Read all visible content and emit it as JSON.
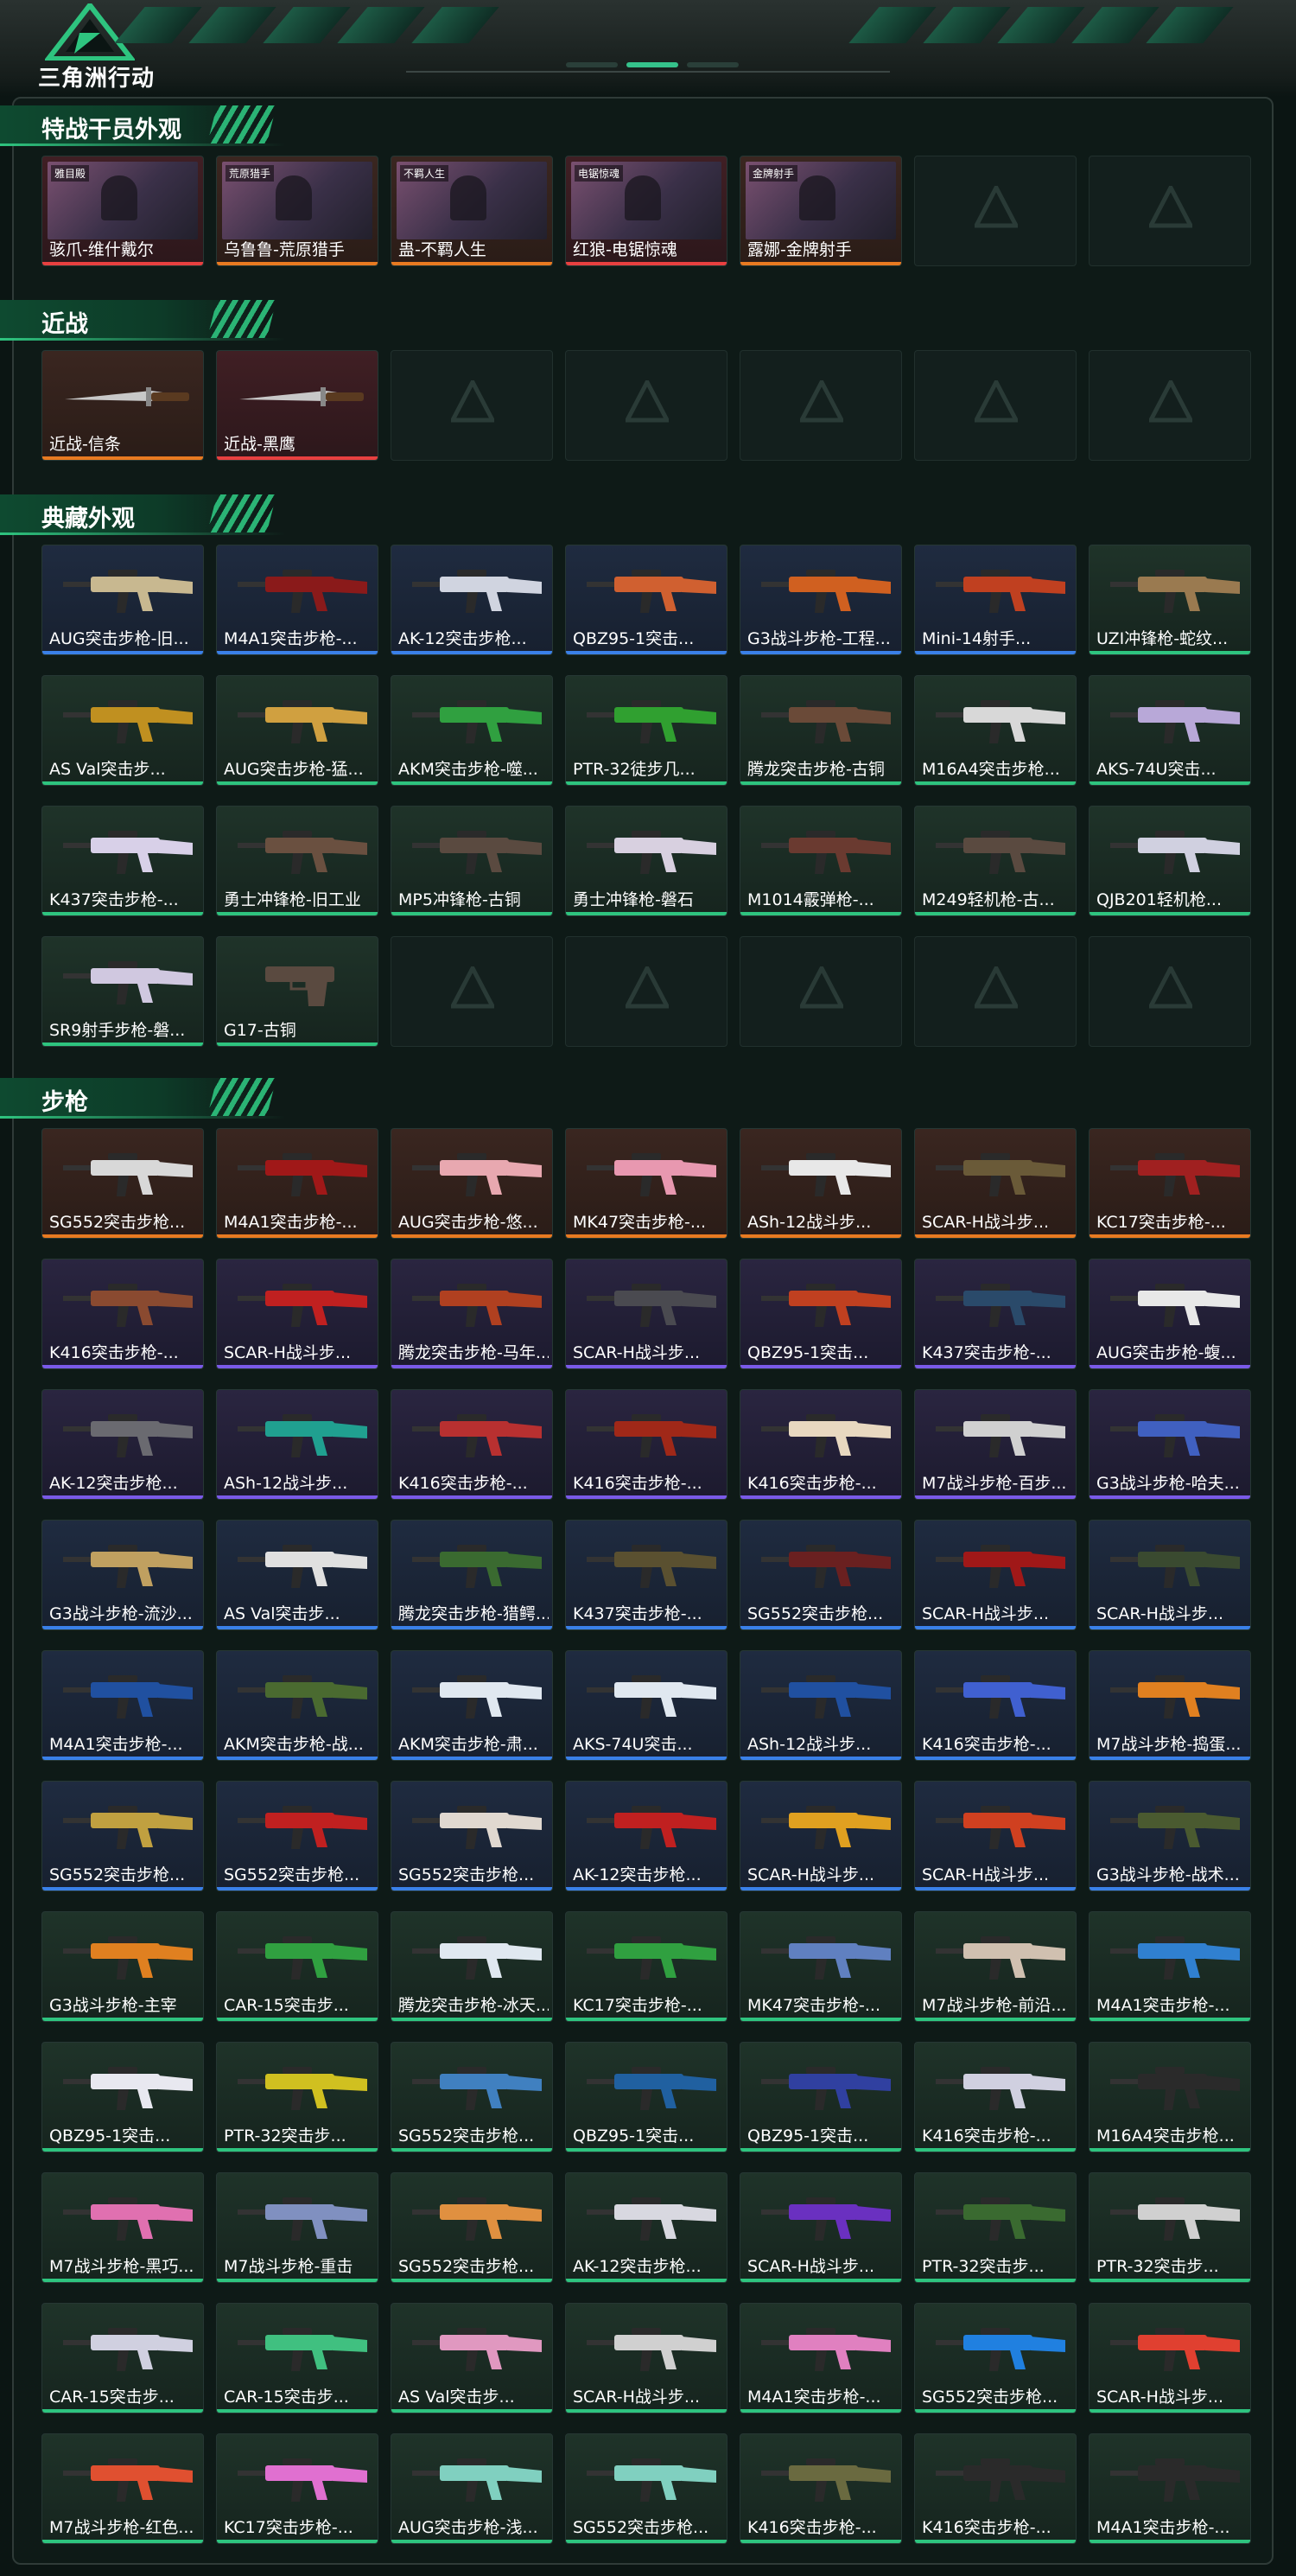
{
  "app": {
    "logo_text": "三角洲行动"
  },
  "header": {
    "progress_active_index": 1
  },
  "sections": [
    {
      "id": "operator-skins",
      "title": "特战干员外观",
      "items": [
        {
          "label": "骇爪-维什戴尔",
          "rarity": "red",
          "kind": "portrait",
          "badge": "雅目殿"
        },
        {
          "label": "乌鲁鲁-荒原猎手",
          "rarity": "orange",
          "kind": "portrait",
          "badge": "荒原猎手"
        },
        {
          "label": "蛊-不羁人生",
          "rarity": "orange",
          "kind": "portrait",
          "badge": "不羁人生"
        },
        {
          "label": "红狼-电锯惊魂",
          "rarity": "red",
          "kind": "portrait",
          "badge": "电锯惊魂"
        },
        {
          "label": "露娜-金牌射手",
          "rarity": "orange",
          "kind": "portrait",
          "badge": "金牌射手"
        },
        {
          "label": "",
          "rarity": "empty",
          "kind": "empty"
        },
        {
          "label": "",
          "rarity": "empty",
          "kind": "empty"
        }
      ]
    },
    {
      "id": "melee",
      "title": "近战",
      "items": [
        {
          "label": "近战-信条",
          "rarity": "orange",
          "kind": "knife"
        },
        {
          "label": "近战-黑鹰",
          "rarity": "red",
          "kind": "knife"
        },
        {
          "label": "",
          "rarity": "empty",
          "kind": "empty"
        },
        {
          "label": "",
          "rarity": "empty",
          "kind": "empty"
        },
        {
          "label": "",
          "rarity": "empty",
          "kind": "empty"
        },
        {
          "label": "",
          "rarity": "empty",
          "kind": "empty"
        },
        {
          "label": "",
          "rarity": "empty",
          "kind": "empty"
        }
      ]
    },
    {
      "id": "collection",
      "title": "典藏外观",
      "items": [
        {
          "label": "AUG突击步枪-旧...",
          "rarity": "blue",
          "kind": "gun",
          "color": "#c8b890"
        },
        {
          "label": "M4A1突击步枪-...",
          "rarity": "blue",
          "kind": "gun",
          "color": "#8a1a1a"
        },
        {
          "label": "AK-12突击步枪...",
          "rarity": "blue",
          "kind": "gun",
          "color": "#d0d4e0"
        },
        {
          "label": "QBZ95-1突击...",
          "rarity": "blue",
          "kind": "gun",
          "color": "#d06030"
        },
        {
          "label": "G3战斗步枪-工程...",
          "rarity": "blue",
          "kind": "gun",
          "color": "#d06020"
        },
        {
          "label": "Mini-14射手...",
          "rarity": "blue",
          "kind": "gun",
          "color": "#c04020"
        },
        {
          "label": "UZI冲锋枪-蛇纹...",
          "rarity": "green",
          "kind": "gun",
          "color": "#9a7a50"
        },
        {
          "label": "AS Val突击步...",
          "rarity": "green",
          "kind": "gun",
          "color": "#c09020"
        },
        {
          "label": "AUG突击步枪-猛...",
          "rarity": "green",
          "kind": "gun",
          "color": "#d0a040"
        },
        {
          "label": "AKM突击步枪-噬...",
          "rarity": "green",
          "kind": "gun",
          "color": "#30a040"
        },
        {
          "label": "PTR-32徒步几...",
          "rarity": "green",
          "kind": "gun",
          "color": "#30a030"
        },
        {
          "label": "腾龙突击步枪-古铜",
          "rarity": "green",
          "kind": "gun",
          "color": "#6a4a38"
        },
        {
          "label": "M16A4突击步枪...",
          "rarity": "green",
          "kind": "gun",
          "color": "#d8d8d8"
        },
        {
          "label": "AKS-74U突击...",
          "rarity": "green",
          "kind": "gun",
          "color": "#b8a8d8"
        },
        {
          "label": "K437突击步枪-...",
          "rarity": "green",
          "kind": "gun",
          "color": "#d8d0e8"
        },
        {
          "label": "勇士冲锋枪-旧工业",
          "rarity": "green",
          "kind": "gun",
          "color": "#6a5040"
        },
        {
          "label": "MP5冲锋枪-古铜",
          "rarity": "green",
          "kind": "gun",
          "color": "#5a4a40"
        },
        {
          "label": "勇士冲锋枪-磐石",
          "rarity": "green",
          "kind": "gun",
          "color": "#d8d0e0"
        },
        {
          "label": "M1014霰弹枪-...",
          "rarity": "green",
          "kind": "gun",
          "color": "#6a3a30"
        },
        {
          "label": "M249轻机枪-古...",
          "rarity": "green",
          "kind": "gun",
          "color": "#5a4a40"
        },
        {
          "label": "QJB201轻机枪...",
          "rarity": "green",
          "kind": "gun",
          "color": "#d0d0e0"
        },
        {
          "label": "SR9射手步枪-磐...",
          "rarity": "green",
          "kind": "gun",
          "color": "#d0c8e0"
        },
        {
          "label": "G17-古铜",
          "rarity": "green",
          "kind": "pistol",
          "color": "#5a4a40"
        },
        {
          "label": "",
          "rarity": "empty",
          "kind": "empty"
        },
        {
          "label": "",
          "rarity": "empty",
          "kind": "empty"
        },
        {
          "label": "",
          "rarity": "empty",
          "kind": "empty"
        },
        {
          "label": "",
          "rarity": "empty",
          "kind": "empty"
        },
        {
          "label": "",
          "rarity": "empty",
          "kind": "empty"
        }
      ]
    },
    {
      "id": "rifles",
      "title": "步枪",
      "items": [
        {
          "label": "SG552突击步枪...",
          "rarity": "orange",
          "kind": "gun",
          "color": "#d8d8d8"
        },
        {
          "label": "M4A1突击步枪-...",
          "rarity": "orange",
          "kind": "gun",
          "color": "#a01818"
        },
        {
          "label": "AUG突击步枪-悠...",
          "rarity": "orange",
          "kind": "gun",
          "color": "#e8a8b0"
        },
        {
          "label": "MK47突击步枪-...",
          "rarity": "orange",
          "kind": "gun",
          "color": "#e898b0"
        },
        {
          "label": "ASh-12战斗步...",
          "rarity": "orange",
          "kind": "gun",
          "color": "#e8e8e8"
        },
        {
          "label": "SCAR-H战斗步...",
          "rarity": "orange",
          "kind": "gun",
          "color": "#6a5a38"
        },
        {
          "label": "KC17突击步枪-...",
          "rarity": "orange",
          "kind": "gun",
          "color": "#a02020"
        },
        {
          "label": "K416突击步枪-...",
          "rarity": "purple",
          "kind": "gun",
          "color": "#8a4a30"
        },
        {
          "label": "SCAR-H战斗步...",
          "rarity": "purple",
          "kind": "gun",
          "color": "#c02020"
        },
        {
          "label": "腾龙突击步枪-马年...",
          "rarity": "purple",
          "kind": "gun",
          "color": "#b04020"
        },
        {
          "label": "SCAR-H战斗步...",
          "rarity": "purple",
          "kind": "gun",
          "color": "#4a4a50"
        },
        {
          "label": "QBZ95-1突击...",
          "rarity": "purple",
          "kind": "gun",
          "color": "#c04020"
        },
        {
          "label": "K437突击步枪-...",
          "rarity": "purple",
          "kind": "gun",
          "color": "#2a4a6a"
        },
        {
          "label": "AUG突击步枪-蝮...",
          "rarity": "purple",
          "kind": "gun",
          "color": "#e8e8e8"
        },
        {
          "label": "AK-12突击步枪...",
          "rarity": "purple",
          "kind": "gun",
          "color": "#6a6a70"
        },
        {
          "label": "ASh-12战斗步...",
          "rarity": "purple",
          "kind": "gun",
          "color": "#20a090"
        },
        {
          "label": "K416突击步枪-...",
          "rarity": "purple",
          "kind": "gun",
          "color": "#b83030"
        },
        {
          "label": "K416突击步枪-...",
          "rarity": "purple",
          "kind": "gun",
          "color": "#a02818"
        },
        {
          "label": "K416突击步枪-...",
          "rarity": "purple",
          "kind": "gun",
          "color": "#e8d8c0"
        },
        {
          "label": "M7战斗步枪-百步...",
          "rarity": "purple",
          "kind": "gun",
          "color": "#d0d0d0"
        },
        {
          "label": "G3战斗步枪-哈夫...",
          "rarity": "purple",
          "kind": "gun",
          "color": "#4060c0"
        },
        {
          "label": "G3战斗步枪-流沙...",
          "rarity": "blue",
          "kind": "gun",
          "color": "#c0a060"
        },
        {
          "label": "AS Val突击步...",
          "rarity": "blue",
          "kind": "gun",
          "color": "#e0e0e0"
        },
        {
          "label": "腾龙突击步枪-猎鳄...",
          "rarity": "blue",
          "kind": "gun",
          "color": "#3a6a30"
        },
        {
          "label": "K437突击步枪-...",
          "rarity": "blue",
          "kind": "gun",
          "color": "#5a5030"
        },
        {
          "label": "SG552突击步枪...",
          "rarity": "blue",
          "kind": "gun",
          "color": "#6a2020"
        },
        {
          "label": "SCAR-H战斗步...",
          "rarity": "blue",
          "kind": "gun",
          "color": "#a01818"
        },
        {
          "label": "SCAR-H战斗步...",
          "rarity": "blue",
          "kind": "gun",
          "color": "#3a4a30"
        },
        {
          "label": "M4A1突击步枪-...",
          "rarity": "blue",
          "kind": "gun",
          "color": "#2050a0"
        },
        {
          "label": "AKM突击步枪-战...",
          "rarity": "blue",
          "kind": "gun",
          "color": "#4a6a30"
        },
        {
          "label": "AKM突击步枪-肃...",
          "rarity": "blue",
          "kind": "gun",
          "color": "#e0e8f0"
        },
        {
          "label": "AKS-74U突击...",
          "rarity": "blue",
          "kind": "gun",
          "color": "#e0e8f0"
        },
        {
          "label": "ASh-12战斗步...",
          "rarity": "blue",
          "kind": "gun",
          "color": "#2050a0"
        },
        {
          "label": "K416突击步枪-...",
          "rarity": "blue",
          "kind": "gun",
          "color": "#4060d0"
        },
        {
          "label": "M7战斗步枪-捣蛋...",
          "rarity": "blue",
          "kind": "gun",
          "color": "#e08020"
        },
        {
          "label": "SG552突击步枪...",
          "rarity": "blue",
          "kind": "gun",
          "color": "#c0a040"
        },
        {
          "label": "SG552突击步枪...",
          "rarity": "blue",
          "kind": "gun",
          "color": "#c02020"
        },
        {
          "label": "SG552突击步枪...",
          "rarity": "blue",
          "kind": "gun",
          "color": "#e0d8d0"
        },
        {
          "label": "AK-12突击步枪...",
          "rarity": "blue",
          "kind": "gun",
          "color": "#c02020"
        },
        {
          "label": "SCAR-H战斗步...",
          "rarity": "blue",
          "kind": "gun",
          "color": "#e0a020"
        },
        {
          "label": "SCAR-H战斗步...",
          "rarity": "blue",
          "kind": "gun",
          "color": "#d04020"
        },
        {
          "label": "G3战斗步枪-战术...",
          "rarity": "blue",
          "kind": "gun",
          "color": "#4a5a30"
        },
        {
          "label": "G3战斗步枪-主宰",
          "rarity": "green",
          "kind": "gun",
          "color": "#e08020"
        },
        {
          "label": "CAR-15突击步...",
          "rarity": "green",
          "kind": "gun",
          "color": "#30a040"
        },
        {
          "label": "腾龙突击步枪-冰天...",
          "rarity": "green",
          "kind": "gun",
          "color": "#e0e8f0"
        },
        {
          "label": "KC17突击步枪-...",
          "rarity": "green",
          "kind": "gun",
          "color": "#30a040"
        },
        {
          "label": "MK47突击步枪-...",
          "rarity": "green",
          "kind": "gun",
          "color": "#6080c0"
        },
        {
          "label": "M7战斗步枪-前沿...",
          "rarity": "green",
          "kind": "gun",
          "color": "#d0c0b0"
        },
        {
          "label": "M4A1突击步枪-...",
          "rarity": "green",
          "kind": "gun",
          "color": "#3080d0"
        },
        {
          "label": "QBZ95-1突击...",
          "rarity": "green",
          "kind": "gun",
          "color": "#e8e8f0"
        },
        {
          "label": "PTR-32突击步...",
          "rarity": "green",
          "kind": "gun",
          "color": "#d0c020"
        },
        {
          "label": "SG552突击步枪...",
          "rarity": "green",
          "kind": "gun",
          "color": "#4080c0"
        },
        {
          "label": "QBZ95-1突击...",
          "rarity": "green",
          "kind": "gun",
          "color": "#2060a0"
        },
        {
          "label": "QBZ95-1突击...",
          "rarity": "green",
          "kind": "gun",
          "color": "#3040a0"
        },
        {
          "label": "K416突击步枪-...",
          "rarity": "green",
          "kind": "gun",
          "color": "#d0d0e0"
        },
        {
          "label": "M16A4突击步枪...",
          "rarity": "green",
          "kind": "gun",
          "color": "#2a2a2a"
        },
        {
          "label": "M7战斗步枪-黑巧...",
          "rarity": "green",
          "kind": "gun",
          "color": "#e070b0"
        },
        {
          "label": "M7战斗步枪-重击",
          "rarity": "green",
          "kind": "gun",
          "color": "#8090c0"
        },
        {
          "label": "SG552突击步枪...",
          "rarity": "green",
          "kind": "gun",
          "color": "#e09040"
        },
        {
          "label": "AK-12突击步枪...",
          "rarity": "green",
          "kind": "gun",
          "color": "#d8d8e0"
        },
        {
          "label": "SCAR-H战斗步...",
          "rarity": "green",
          "kind": "gun",
          "color": "#6a30c0"
        },
        {
          "label": "PTR-32突击步...",
          "rarity": "green",
          "kind": "gun",
          "color": "#3a6a30"
        },
        {
          "label": "PTR-32突击步...",
          "rarity": "green",
          "kind": "gun",
          "color": "#d0d0d0"
        },
        {
          "label": "CAR-15突击步...",
          "rarity": "green",
          "kind": "gun",
          "color": "#d0d0e0"
        },
        {
          "label": "CAR-15突击步...",
          "rarity": "green",
          "kind": "gun",
          "color": "#40c080"
        },
        {
          "label": "AS Val突击步...",
          "rarity": "green",
          "kind": "gun",
          "color": "#e098c0"
        },
        {
          "label": "SCAR-H战斗步...",
          "rarity": "green",
          "kind": "gun",
          "color": "#d0d0d0"
        },
        {
          "label": "M4A1突击步枪-...",
          "rarity": "green",
          "kind": "gun",
          "color": "#e080c0"
        },
        {
          "label": "SG552突击步枪...",
          "rarity": "green",
          "kind": "gun",
          "color": "#2080e0"
        },
        {
          "label": "SCAR-H战斗步...",
          "rarity": "green",
          "kind": "gun",
          "color": "#e04030"
        },
        {
          "label": "M7战斗步枪-红色...",
          "rarity": "green",
          "kind": "gun",
          "color": "#e05030"
        },
        {
          "label": "KC17突击步枪-...",
          "rarity": "green",
          "kind": "gun",
          "color": "#e070d0"
        },
        {
          "label": "AUG突击步枪-浅...",
          "rarity": "green",
          "kind": "gun",
          "color": "#80d0c0"
        },
        {
          "label": "SG552突击步枪...",
          "rarity": "green",
          "kind": "gun",
          "color": "#80d0c0"
        },
        {
          "label": "K416突击步枪-...",
          "rarity": "green",
          "kind": "gun",
          "color": "#6a6a40"
        },
        {
          "label": "K416突击步枪-...",
          "rarity": "green",
          "kind": "gun",
          "color": "#2a2a2a"
        },
        {
          "label": "M4A1突击步枪-...",
          "rarity": "green",
          "kind": "gun",
          "color": "#2a2a2a"
        }
      ]
    }
  ]
}
